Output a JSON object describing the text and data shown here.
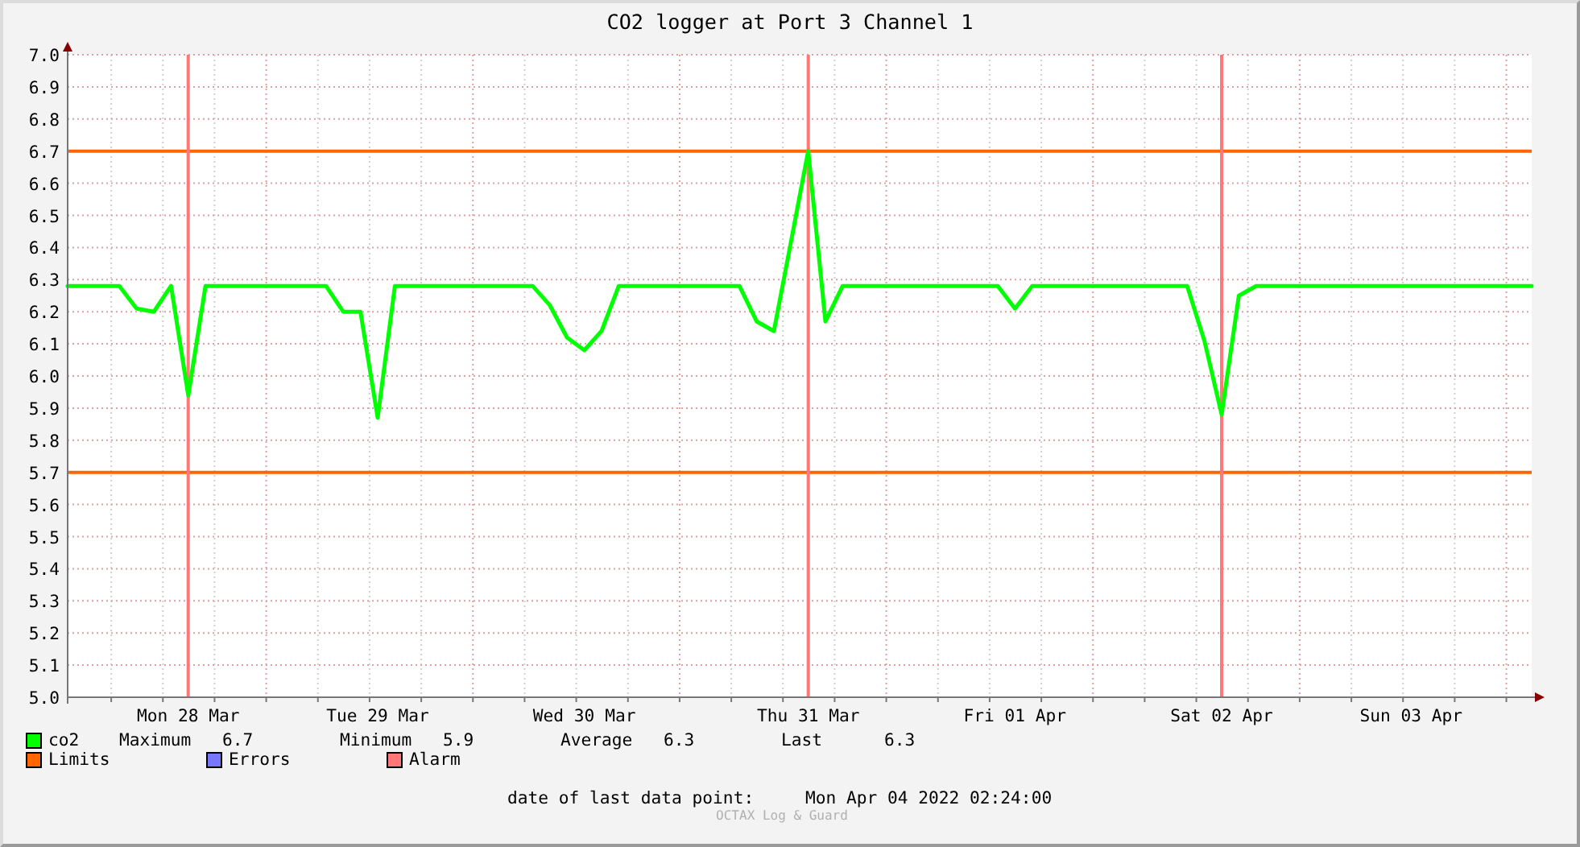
{
  "title": "CO2 logger at Port 3 Channel 1",
  "chart_data": {
    "type": "line",
    "ylim": [
      5,
      7
    ],
    "categories": [
      null,
      null,
      null,
      null,
      null,
      null,
      null,
      "Mon 28 Mar",
      null,
      null,
      null,
      null,
      null,
      null,
      null,
      null,
      null,
      null,
      "Tue 29 Mar",
      null,
      null,
      null,
      null,
      null,
      null,
      null,
      null,
      null,
      null,
      null,
      "Wed 30 Mar",
      null,
      null,
      null,
      null,
      null,
      null,
      null,
      null,
      null,
      null,
      null,
      null,
      "Thu 31 Mar",
      null,
      null,
      null,
      null,
      null,
      null,
      null,
      null,
      null,
      null,
      null,
      "Fri 01 Apr",
      null,
      null,
      null,
      null,
      null,
      null,
      null,
      null,
      null,
      null,
      null,
      "Sat 02 Apr",
      null,
      null,
      null,
      null,
      null,
      null,
      null,
      null,
      null,
      null,
      "Sun 03 Apr",
      null,
      null,
      null,
      null,
      null,
      null,
      null
    ],
    "series": [
      {
        "name": "co2",
        "color": "#00ff00",
        "values": [
          6.28,
          6.28,
          6.28,
          6.28,
          6.21,
          6.2,
          6.28,
          5.94,
          6.28,
          6.28,
          6.28,
          6.28,
          6.28,
          6.28,
          6.28,
          6.28,
          6.2,
          6.2,
          5.87,
          6.28,
          6.28,
          6.28,
          6.28,
          6.28,
          6.28,
          6.28,
          6.28,
          6.28,
          6.22,
          6.12,
          6.08,
          6.14,
          6.28,
          6.28,
          6.28,
          6.28,
          6.28,
          6.28,
          6.28,
          6.28,
          6.17,
          6.14,
          6.42,
          6.7,
          6.17,
          6.28,
          6.28,
          6.28,
          6.28,
          6.28,
          6.28,
          6.28,
          6.28,
          6.28,
          6.28,
          6.21,
          6.28,
          6.28,
          6.28,
          6.28,
          6.28,
          6.28,
          6.28,
          6.28,
          6.28,
          6.28,
          6.11,
          5.88,
          6.25,
          6.28,
          6.28,
          6.28,
          6.28,
          6.28,
          6.28,
          6.28,
          6.28,
          6.28,
          6.28,
          6.28,
          6.28,
          6.28,
          6.28,
          6.28,
          6.28,
          6.28
        ]
      }
    ],
    "yticks": [
      {
        "value": 5,
        "label": "5.0"
      },
      5.1,
      5.2,
      5.3,
      5.4,
      5.5,
      5.6,
      5.7,
      5.8,
      5.9,
      {
        "value": 6,
        "label": "6.0"
      },
      6.1,
      6.2,
      6.3,
      6.4,
      6.5,
      6.6,
      6.7,
      6.8,
      6.9,
      {
        "value": 7,
        "label": "7.0"
      }
    ],
    "grid": true
  },
  "legend": [
    {
      "color": "#00ff00"
    },
    {
      "label": "Limits",
      "color": "#ff6600"
    },
    {
      "label": "Errors",
      "color": "#7777ff"
    },
    {
      "label": "Alarm",
      "color": "#ff7777"
    }
  ],
  "stats": [
    {
      "label": "Maximum",
      "value": "6.7"
    },
    {
      "label": "Minimum",
      "value": "5.9"
    },
    {
      "label": "Average",
      "value": "6.3"
    },
    {
      "label": "Last",
      "value": "6.3"
    }
  ],
  "last_update": {
    "label": "date of last data point:",
    "value": "Mon Apr 04 2022 02:24:00"
  },
  "watermark": "OCTAX Log & Guard"
}
